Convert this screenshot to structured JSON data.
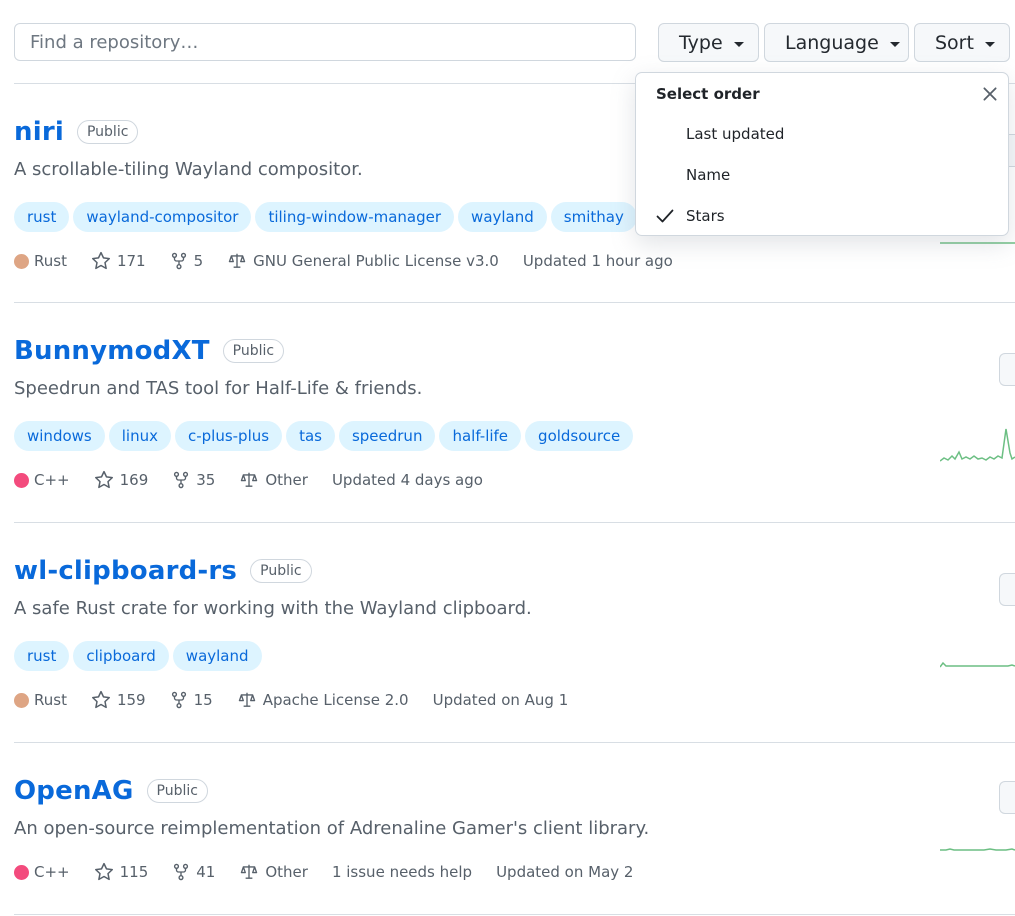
{
  "toolbar": {
    "search_placeholder": "Find a repository…",
    "type_label": "Type",
    "language_label": "Language",
    "sort_label": "Sort"
  },
  "sort_menu": {
    "title": "Select order",
    "options": [
      {
        "label": "Last updated",
        "selected": false
      },
      {
        "label": "Name",
        "selected": false
      },
      {
        "label": "Stars",
        "selected": true
      }
    ]
  },
  "repos": [
    {
      "name": "niri",
      "visibility": "Public",
      "description": "A scrollable-tiling Wayland compositor.",
      "topics": [
        "rust",
        "wayland-compositor",
        "tiling-window-manager",
        "wayland",
        "smithay"
      ],
      "language": "Rust",
      "language_color": "#dea584",
      "stars": "171",
      "forks": "5",
      "license": "GNU General Public License v3.0",
      "updated": "Updated 1 hour ago"
    },
    {
      "name": "BunnymodXT",
      "visibility": "Public",
      "description": "Speedrun and TAS tool for Half-Life & friends.",
      "topics": [
        "windows",
        "linux",
        "c-plus-plus",
        "tas",
        "speedrun",
        "half-life",
        "goldsource"
      ],
      "language": "C++",
      "language_color": "#f34b7d",
      "stars": "169",
      "forks": "35",
      "license": "Other",
      "updated": "Updated 4 days ago"
    },
    {
      "name": "wl-clipboard-rs",
      "visibility": "Public",
      "description": "A safe Rust crate for working with the Wayland clipboard.",
      "topics": [
        "rust",
        "clipboard",
        "wayland"
      ],
      "language": "Rust",
      "language_color": "#dea584",
      "stars": "159",
      "forks": "15",
      "license": "Apache License 2.0",
      "updated": "Updated on Aug 1"
    },
    {
      "name": "OpenAG",
      "visibility": "Public",
      "description": "An open-source reimplementation of Adrenaline Gamer's client library.",
      "topics": [],
      "language": "C++",
      "language_color": "#f34b7d",
      "stars": "115",
      "forks": "41",
      "license": "Other",
      "issues": "1 issue needs help",
      "updated": "Updated on May 2"
    }
  ],
  "colors": {
    "link": "#0969da",
    "topic_bg": "#ddf4ff",
    "spark": "#2da44e"
  }
}
